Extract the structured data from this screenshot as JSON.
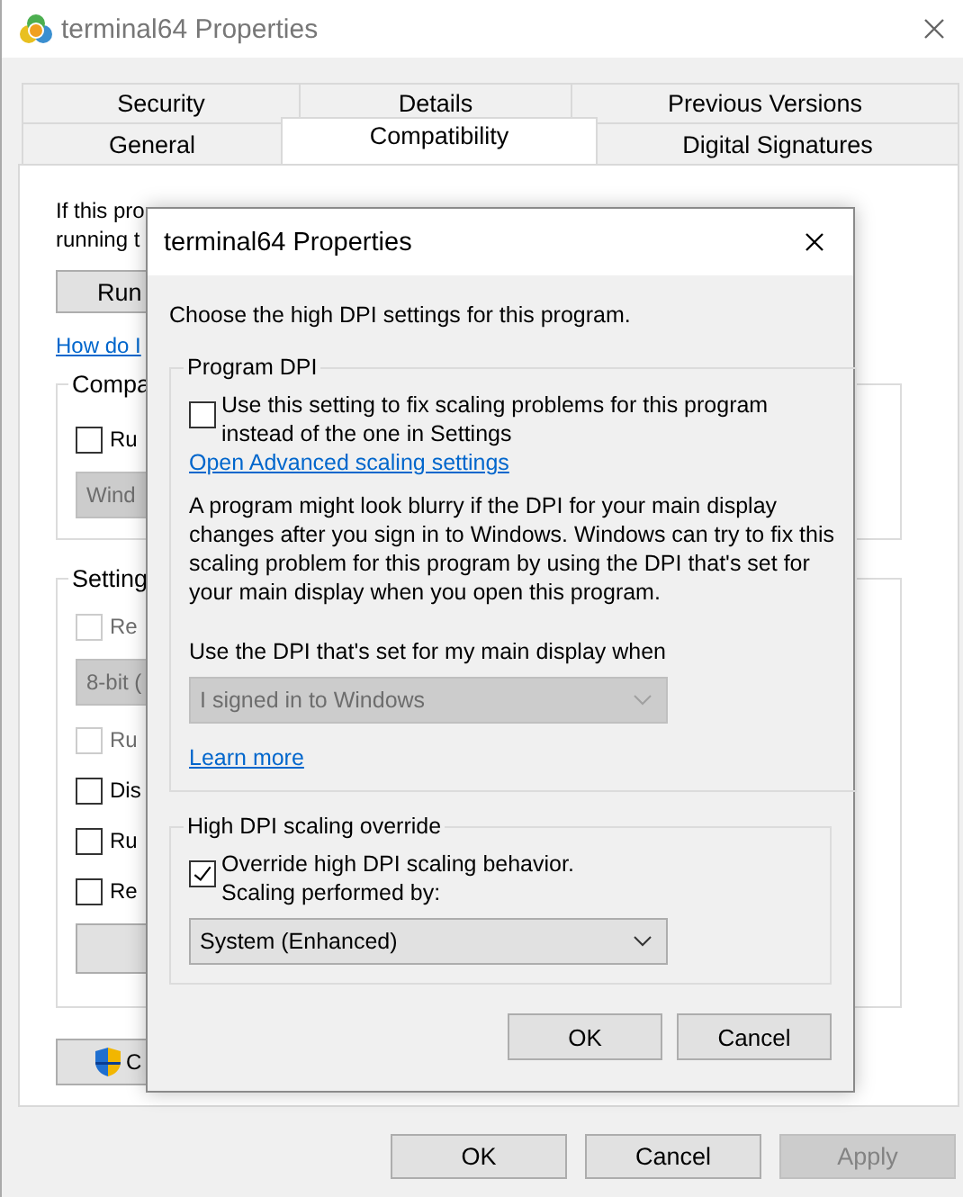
{
  "window": {
    "title": "terminal64 Properties"
  },
  "tab_rows": [
    [
      {
        "label": "Security",
        "selected": false
      },
      {
        "label": "Details",
        "selected": false
      },
      {
        "label": "Previous Versions",
        "selected": false
      }
    ],
    [
      {
        "label": "General",
        "selected": false
      },
      {
        "label": "Compatibility",
        "selected": true
      },
      {
        "label": "Digital Signatures",
        "selected": false
      }
    ]
  ],
  "panel": {
    "intro_lines": [
      "If this pro",
      "running t"
    ],
    "run_button": "Run",
    "help_link": "How do I",
    "compat_group": {
      "legend": "Compa",
      "checkbox": {
        "label": "Ru",
        "checked": false,
        "disabled": false
      },
      "dropdown": {
        "value": "Wind",
        "disabled": true
      }
    },
    "settings_group": {
      "legend": "Setting",
      "items": [
        {
          "kind": "checkbox",
          "label": "Re",
          "checked": false,
          "disabled": true
        },
        {
          "kind": "dropdown",
          "value": "8-bit (",
          "disabled": true
        },
        {
          "kind": "checkbox",
          "label": "Ru",
          "checked": false,
          "disabled": true
        },
        {
          "kind": "checkbox",
          "label": "Dis",
          "checked": false,
          "disabled": false
        },
        {
          "kind": "checkbox",
          "label": "Ru",
          "checked": false,
          "disabled": false
        },
        {
          "kind": "checkbox",
          "label": "Re",
          "checked": false,
          "disabled": false
        },
        {
          "kind": "button"
        }
      ]
    },
    "change_button": "C"
  },
  "dialog": {
    "title": "terminal64 Properties",
    "intro": "Choose the high DPI settings for this program.",
    "program_dpi": {
      "legend": "Program DPI",
      "checkbox": {
        "label": "Use this setting to fix scaling problems for this program instead of the one in Settings",
        "checked": false
      },
      "link": "Open Advanced scaling settings",
      "paragraph": "A program might look blurry if the DPI for your main display changes after you sign in to Windows. Windows can try to fix this scaling problem for this program by using the DPI that's set for your main display when you open this program.",
      "dropdown_label": "Use the DPI that's set for my main display when",
      "dropdown": {
        "value": "I signed in to Windows",
        "disabled": true
      },
      "learn_more": "Learn more"
    },
    "override": {
      "legend": "High DPI scaling override",
      "checkbox": {
        "label": "Override high DPI scaling behavior.\nScaling performed by:",
        "checked": true
      },
      "dropdown": {
        "value": "System (Enhanced)",
        "disabled": false
      }
    },
    "buttons": [
      {
        "label": "OK",
        "disabled": false
      },
      {
        "label": "Cancel",
        "disabled": false
      }
    ]
  },
  "buttons": [
    {
      "label": "OK",
      "disabled": false
    },
    {
      "label": "Cancel",
      "disabled": false
    },
    {
      "label": "Apply",
      "disabled": true
    }
  ]
}
